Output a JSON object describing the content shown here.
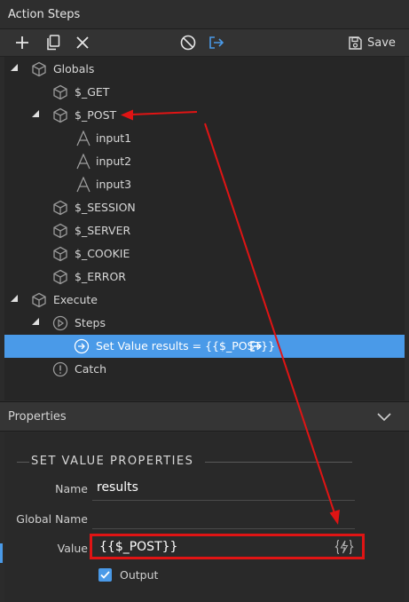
{
  "window": {
    "title": "Action Steps"
  },
  "toolbar": {
    "add_icon": "plus-icon",
    "copy_icon": "copy-icon",
    "delete_icon": "close-icon",
    "disable_icon": "ban-icon",
    "export_icon": "export-icon",
    "save_label": "Save"
  },
  "tree": {
    "items": [
      {
        "label": "Globals",
        "icon": "cube-icon",
        "expanded": true
      },
      {
        "label": "$_GET",
        "icon": "cube-icon"
      },
      {
        "label": "$_POST",
        "icon": "cube-icon",
        "expanded": true
      },
      {
        "label": "input1",
        "icon": "text-icon"
      },
      {
        "label": "input2",
        "icon": "text-icon"
      },
      {
        "label": "input3",
        "icon": "text-icon"
      },
      {
        "label": "$_SESSION",
        "icon": "cube-icon"
      },
      {
        "label": "$_SERVER",
        "icon": "cube-icon"
      },
      {
        "label": "$_COOKIE",
        "icon": "cube-icon"
      },
      {
        "label": "$_ERROR",
        "icon": "cube-icon"
      },
      {
        "label": "Execute",
        "icon": "cube-icon",
        "expanded": true
      },
      {
        "label": "Steps",
        "icon": "play-circle-icon",
        "expanded": true
      },
      {
        "label": "Set Value results = {{$_POST}}",
        "icon": "arrow-circle-icon",
        "selected": true
      },
      {
        "label": "Catch",
        "icon": "exclamation-circle-icon"
      }
    ]
  },
  "properties": {
    "header": "Properties",
    "section_title": "SET VALUE PROPERTIES",
    "name_label": "Name",
    "name_value": "results",
    "global_name_label": "Global Name",
    "global_name_value": "",
    "value_label": "Value",
    "value_value": "{{$_POST}}",
    "output_label": "Output",
    "output_checked": true
  },
  "colors": {
    "accent": "#4a9ae8",
    "annotation": "#e01414",
    "background": "#2b2b2b"
  }
}
